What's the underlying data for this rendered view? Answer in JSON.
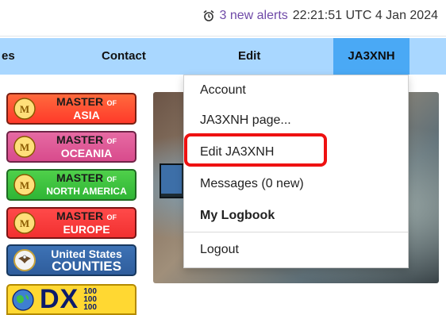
{
  "status": {
    "alerts_link": "3 new alerts",
    "datetime": "22:21:51 UTC 4 Jan 2024"
  },
  "nav": {
    "partial_item": "es",
    "contact": "Contact",
    "edit": "Edit",
    "user": "JA3XNH"
  },
  "dropdown": {
    "items": [
      "Account",
      "JA3XNH page...",
      "Edit JA3XNH",
      "Messages (0 new)",
      "My Logbook",
      "Logout"
    ],
    "highlighted_item": "Edit JA3XNH"
  },
  "badges": {
    "asia": {
      "line1": "MASTER",
      "of": "OF",
      "line2": "ASIA"
    },
    "oceania": {
      "line1": "MASTER",
      "of": "OF",
      "line2": "OCEANIA"
    },
    "north_america": {
      "line1": "MASTER",
      "of": "OF",
      "line2": "NORTH AMERICA"
    },
    "europe": {
      "line1": "MASTER",
      "of": "OF",
      "line2": "EUROPE"
    },
    "counties": {
      "line1": "United States",
      "line2": "COUNTIES"
    },
    "dx": {
      "main": "DX",
      "n1": "100",
      "n2": "100",
      "n3": "100"
    }
  },
  "colors": {
    "nav_bg": "#a9d7ff",
    "nav_active": "#4aa9f5",
    "highlight_border": "#ee1111",
    "alerts_link": "#6f4aa8"
  },
  "icons": {
    "alerts": "alarm-clock-icon",
    "badge": "medal-icon",
    "counties": "eagle-seal-icon",
    "dx": "globe-icon"
  }
}
